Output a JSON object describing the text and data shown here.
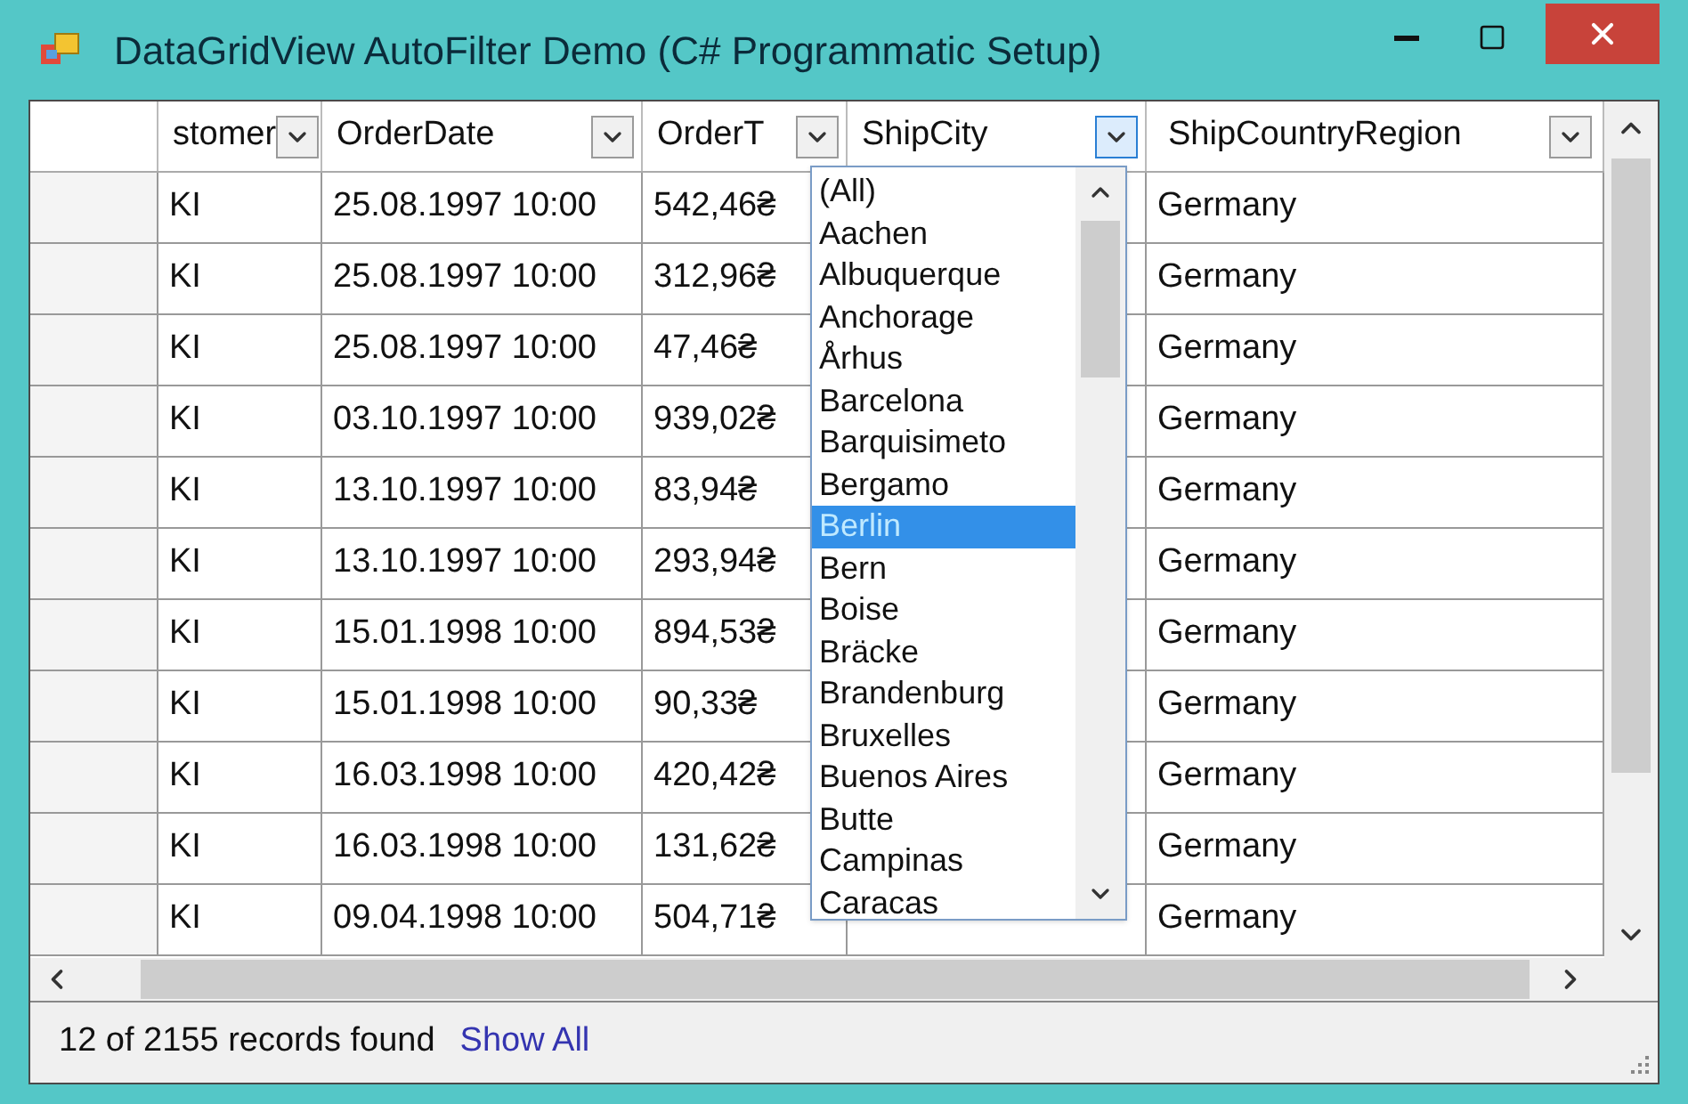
{
  "window": {
    "title": "DataGridView AutoFilter Demo (C# Programmatic Setup)"
  },
  "table": {
    "columns": [
      {
        "label": "stomer",
        "filter_open": false
      },
      {
        "label": "OrderDate",
        "filter_open": false
      },
      {
        "label": "OrderT",
        "filter_open": false
      },
      {
        "label": "ShipCity",
        "filter_open": true
      },
      {
        "label": "ShipCountryRegion",
        "filter_open": false
      }
    ],
    "rows": [
      {
        "customer": "KI",
        "order_date": "25.08.1997 10:00",
        "order_total": "542,46₴",
        "ship_country_region": "Germany"
      },
      {
        "customer": "KI",
        "order_date": "25.08.1997 10:00",
        "order_total": "312,96₴",
        "ship_country_region": "Germany"
      },
      {
        "customer": "KI",
        "order_date": "25.08.1997 10:00",
        "order_total": "47,46₴",
        "ship_country_region": "Germany"
      },
      {
        "customer": "KI",
        "order_date": "03.10.1997 10:00",
        "order_total": "939,02₴",
        "ship_country_region": "Germany"
      },
      {
        "customer": "KI",
        "order_date": "13.10.1997 10:00",
        "order_total": "83,94₴",
        "ship_country_region": "Germany"
      },
      {
        "customer": "KI",
        "order_date": "13.10.1997 10:00",
        "order_total": "293,94₴",
        "ship_country_region": "Germany"
      },
      {
        "customer": "KI",
        "order_date": "15.01.1998 10:00",
        "order_total": "894,53₴",
        "ship_country_region": "Germany"
      },
      {
        "customer": "KI",
        "order_date": "15.01.1998 10:00",
        "order_total": "90,33₴",
        "ship_country_region": "Germany"
      },
      {
        "customer": "KI",
        "order_date": "16.03.1998 10:00",
        "order_total": "420,42₴",
        "ship_country_region": "Germany"
      },
      {
        "customer": "KI",
        "order_date": "16.03.1998 10:00",
        "order_total": "131,62₴",
        "ship_country_region": "Germany"
      },
      {
        "customer": "KI",
        "order_date": "09.04.1998 10:00",
        "order_total": "504,71₴",
        "ship_country_region": "Germany"
      }
    ]
  },
  "filter_list": {
    "items": [
      {
        "label": "(All)",
        "selected": false
      },
      {
        "label": "Aachen",
        "selected": false
      },
      {
        "label": "Albuquerque",
        "selected": false
      },
      {
        "label": "Anchorage",
        "selected": false
      },
      {
        "label": "Århus",
        "selected": false
      },
      {
        "label": "Barcelona",
        "selected": false
      },
      {
        "label": "Barquisimeto",
        "selected": false
      },
      {
        "label": "Bergamo",
        "selected": false
      },
      {
        "label": "Berlin",
        "selected": true
      },
      {
        "label": "Bern",
        "selected": false
      },
      {
        "label": "Boise",
        "selected": false
      },
      {
        "label": "Bräcke",
        "selected": false
      },
      {
        "label": "Brandenburg",
        "selected": false
      },
      {
        "label": "Bruxelles",
        "selected": false
      },
      {
        "label": "Buenos Aires",
        "selected": false
      },
      {
        "label": "Butte",
        "selected": false
      },
      {
        "label": "Campinas",
        "selected": false
      },
      {
        "label": "Caracas",
        "selected": false
      }
    ]
  },
  "status_bar": {
    "text": "12 of 2155 records found",
    "link": "Show All"
  }
}
